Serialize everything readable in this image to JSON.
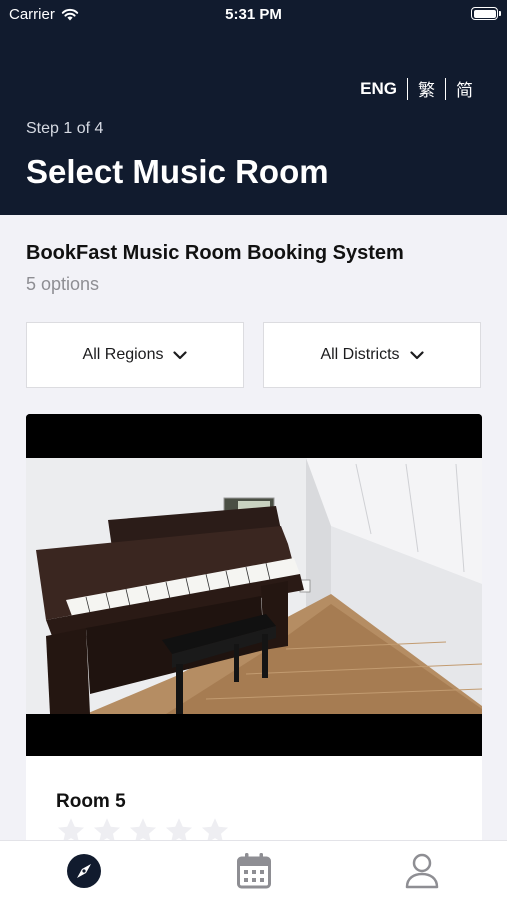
{
  "status_bar": {
    "carrier": "Carrier",
    "time": "5:31 PM"
  },
  "header": {
    "languages": [
      "ENG",
      "繁",
      "简"
    ],
    "step": "Step 1 of 4",
    "title": "Select Music Room"
  },
  "main": {
    "system_name": "BookFast Music Room Booking System",
    "options_count": "5 options",
    "filters": {
      "region": "All Regions",
      "district": "All Districts"
    },
    "rooms": [
      {
        "name": "Room 5",
        "rating": 0,
        "max_rating": 5
      }
    ]
  },
  "tabbar": {
    "icons": [
      "compass-icon",
      "calendar-icon",
      "person-icon"
    ]
  },
  "colors": {
    "header_bg": "#111b2e",
    "page_bg": "#f2f2f7",
    "star_empty": "#eeeef2"
  }
}
